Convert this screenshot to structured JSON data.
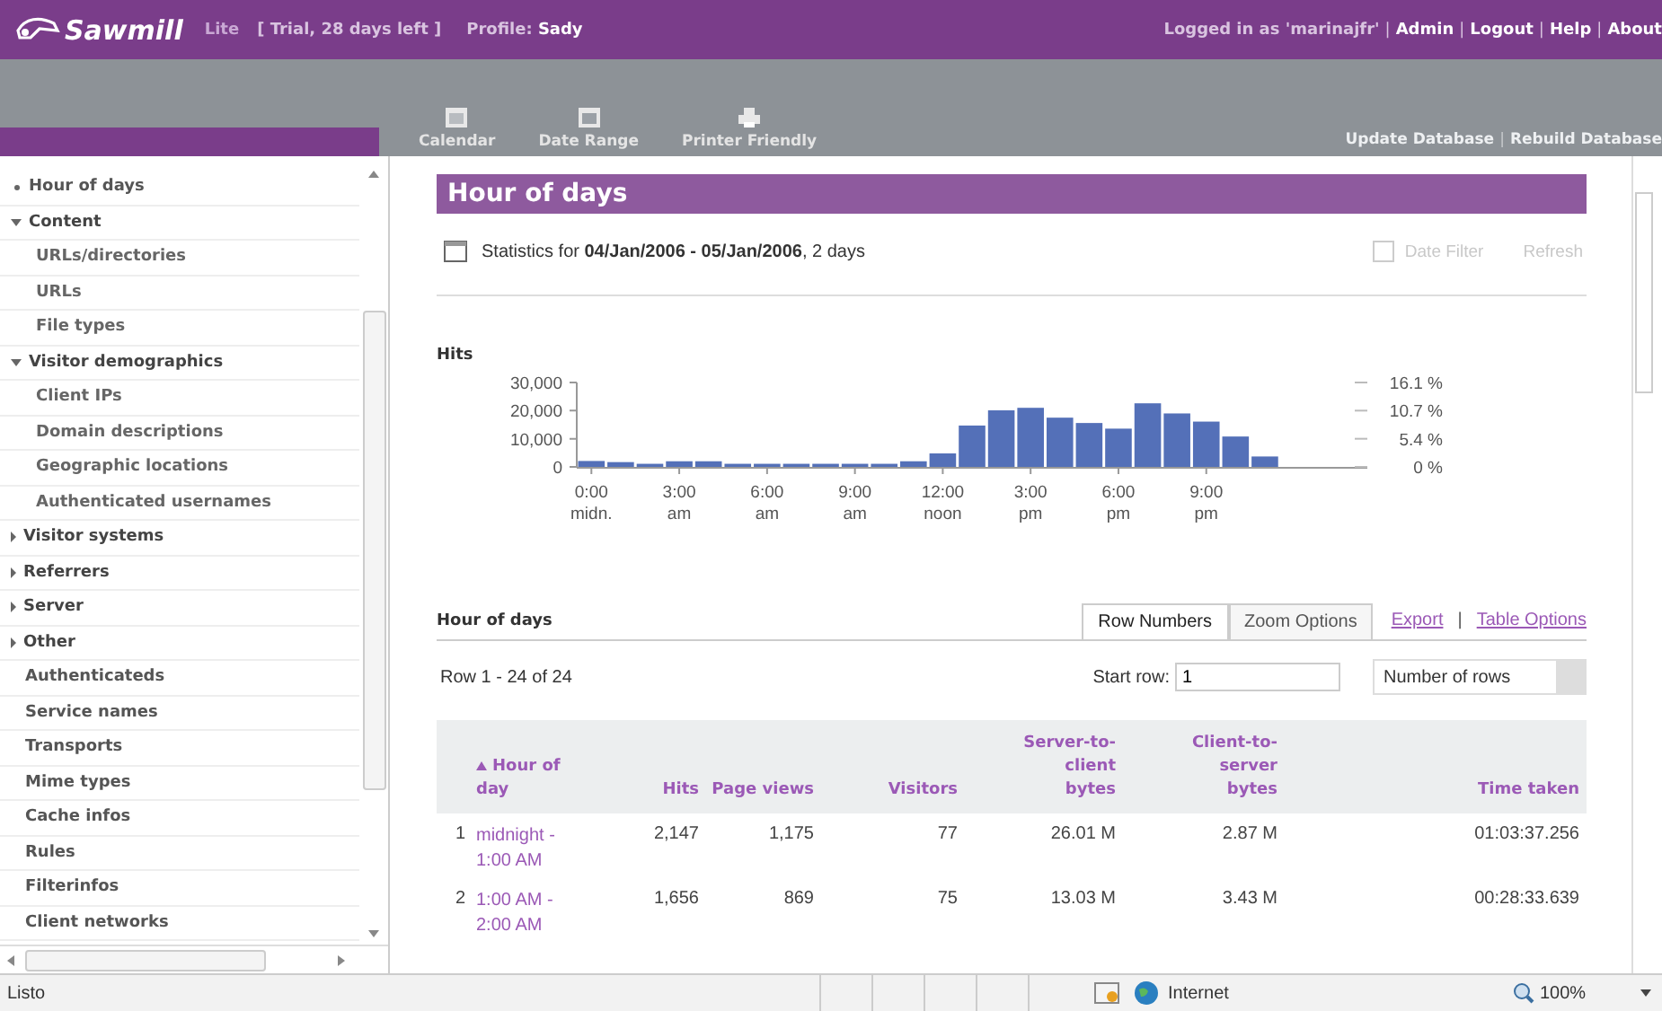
{
  "header": {
    "app_name": "Sawmill",
    "edition": "Lite",
    "trial": "[ Trial, 28 days left ]",
    "profile": "Profile: **Sady**",
    "links": [
      {
        "text": "Logged in as 'marinajfr'",
        "kind": "label"
      },
      {
        "text": "|",
        "kind": "sep"
      },
      {
        "text": "Admin",
        "kind": "link"
      },
      {
        "text": "|",
        "kind": "sep"
      },
      {
        "text": "Logout",
        "kind": "link"
      },
      {
        "text": "|",
        "kind": "sep"
      },
      {
        "text": "Help",
        "kind": "link"
      },
      {
        "text": "|",
        "kind": "sep"
      },
      {
        "text": "About",
        "kind": "link"
      }
    ]
  },
  "toolbar": {
    "buttons": [
      {
        "label": "Calendar",
        "kind": "calendar"
      },
      {
        "label": "Date Range",
        "kind": "range"
      },
      {
        "label": "Printer Friendly",
        "kind": "printer"
      }
    ],
    "links": [
      {
        "text": "Update Database",
        "kind": "link"
      },
      {
        "text": "|",
        "kind": "sep"
      },
      {
        "text": "Rebuild Database",
        "kind": "link"
      }
    ]
  },
  "sidebar": {
    "items": [
      {
        "label": "Hour of days",
        "kind": "bullet"
      },
      {
        "label": "Content",
        "kind": "group",
        "expanded": true,
        "children": [
          {
            "label": "URLs/directories"
          },
          {
            "label": "URLs"
          },
          {
            "label": "File types"
          }
        ]
      },
      {
        "label": "Visitor demographics",
        "kind": "group",
        "expanded": true,
        "children": [
          {
            "label": "Client IPs"
          },
          {
            "label": "Domain descriptions"
          },
          {
            "label": "Geographic locations"
          },
          {
            "label": "Authenticated usernames"
          }
        ]
      },
      {
        "label": "Visitor systems",
        "kind": "group",
        "expanded": false
      },
      {
        "label": "Referrers",
        "kind": "group",
        "expanded": false
      },
      {
        "label": "Server",
        "kind": "group",
        "expanded": false
      },
      {
        "label": "Other",
        "kind": "group",
        "expanded": false
      },
      {
        "label": "Authenticateds",
        "kind": "link"
      },
      {
        "label": "Service names",
        "kind": "link"
      },
      {
        "label": "Transports",
        "kind": "link"
      },
      {
        "label": "Mime types",
        "kind": "link"
      },
      {
        "label": "Cache infos",
        "kind": "link"
      },
      {
        "label": "Rules",
        "kind": "link"
      },
      {
        "label": "Filterinfos",
        "kind": "link"
      },
      {
        "label": "Client networks",
        "kind": "link"
      }
    ]
  },
  "report": {
    "title": "Hour of days",
    "statistics": "Statistics for **04/Jan/2006 - 05/Jan/2006**, 2 days",
    "date_filter": {
      "label": "Date Filter",
      "checked": false,
      "disabled": true
    },
    "refresh": {
      "label": "Refresh",
      "disabled": true
    },
    "percent_labels": [
      "16.1 %",
      "10.7 %",
      "5.4 %",
      "0 %"
    ],
    "chart_data": {
      "type": "bar",
      "ylabel": "Hits",
      "x": [
        0,
        1,
        2,
        3,
        4,
        5,
        6,
        7,
        8,
        9,
        10,
        11,
        12,
        13,
        14,
        15,
        16,
        17,
        18,
        19,
        20,
        21,
        22,
        23
      ],
      "series": [
        {
          "color": "#5470b8",
          "values": [
            2100,
            1700,
            1100,
            2000,
            2000,
            1100,
            1100,
            1100,
            1100,
            1100,
            1100,
            2000,
            4800,
            14700,
            20100,
            21000,
            17500,
            15600,
            13600,
            22600,
            19000,
            16100,
            10800,
            3700
          ]
        }
      ],
      "xlim": [
        -0.5,
        26.5
      ],
      "ylim": [
        0,
        30000
      ],
      "yticks": [
        {
          "value": 0,
          "label": "0"
        },
        {
          "value": 10000,
          "label": "10,000"
        },
        {
          "value": 20000,
          "label": "20,000"
        },
        {
          "value": 30000,
          "label": "30,000"
        }
      ],
      "xticks": [
        {
          "value": 0,
          "label": "0:00\nmidn."
        },
        {
          "value": 3,
          "label": "3:00\nam"
        },
        {
          "value": 6,
          "label": "6:00\nam"
        },
        {
          "value": 9,
          "label": "9:00\nam"
        },
        {
          "value": 12,
          "label": "12:00\nnoon"
        },
        {
          "value": 15,
          "label": "3:00\npm"
        },
        {
          "value": 18,
          "label": "6:00\npm"
        },
        {
          "value": 21,
          "label": "9:00\npm"
        }
      ]
    }
  },
  "table": {
    "title": "Hour of days",
    "tabs": [
      {
        "label": "Row Numbers",
        "selected": true
      },
      {
        "label": "Zoom Options",
        "selected": false
      }
    ],
    "links": [
      {
        "text": "Export",
        "kind": "link"
      },
      {
        "text": "|",
        "kind": "sep"
      },
      {
        "text": "Table Options",
        "kind": "link"
      }
    ],
    "row_count": "Row 1 - 24 of 24",
    "start_row": {
      "label": "Start row:",
      "value": "1"
    },
    "rows_select": "Number of rows",
    "columns": [
      {
        "sorted": false
      },
      {
        "label": "Hour of day",
        "sorted": true
      },
      {
        "label": "Hits",
        "sorted": false
      },
      {
        "label": "Page views",
        "sorted": false
      },
      {
        "label": "Visitors",
        "sorted": false
      },
      {
        "label": "Server-to-client bytes",
        "sorted": false
      },
      {
        "label": "Client-to-server bytes",
        "sorted": false
      },
      {
        "label": "Time taken",
        "sorted": false
      }
    ],
    "rows": [
      [
        "1",
        "midnight - 1:00 AM",
        "2,147",
        "1,175",
        "77",
        "26.01 M",
        "2.87 M",
        "01:03:37.256"
      ],
      [
        "2",
        "1:00 AM - 2:00 AM",
        "1,656",
        "869",
        "75",
        "13.03 M",
        "3.43 M",
        "00:28:33.639"
      ]
    ]
  },
  "status_bar": {
    "text": "Listo",
    "zone": "Internet",
    "zoom": "100%"
  }
}
